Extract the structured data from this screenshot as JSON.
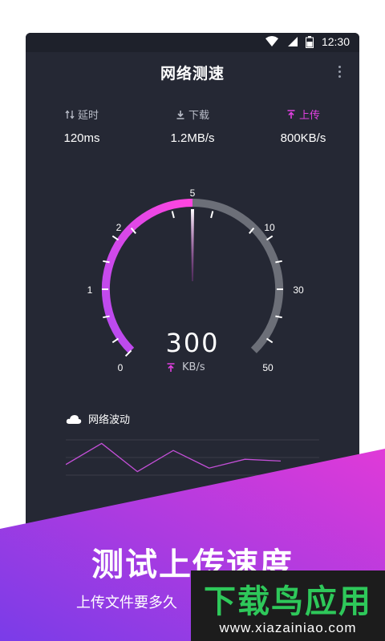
{
  "status_bar": {
    "time": "12:30"
  },
  "header": {
    "title": "网络测速"
  },
  "stats": [
    {
      "label": "延时",
      "value": "120ms",
      "icon": "latency-arrows-icon",
      "color": "#b9bdc8"
    },
    {
      "label": "下载",
      "value": "1.2MB/s",
      "icon": "download-icon",
      "color": "#b9bdc8"
    },
    {
      "label": "上传",
      "value": "800KB/s",
      "icon": "upload-icon",
      "color": "#e040e0"
    }
  ],
  "gauge": {
    "current_value": "300",
    "unit": "KB/s",
    "scale_labels": [
      "0",
      "1",
      "2",
      "5",
      "10",
      "30",
      "50"
    ],
    "needle_position_label": "5",
    "accent_gradient": [
      "#b34bf0",
      "#ff45e0"
    ],
    "track_color": "#6c6f78"
  },
  "wave": {
    "title": "网络波动",
    "points": [
      0.3,
      0.9,
      0.1,
      0.7,
      0.2,
      0.45,
      0.4
    ],
    "line_color": "#c44fd8"
  },
  "promo": {
    "title": "测试上传速度",
    "subtitle": "上传文件要多久",
    "gradient": [
      "#7a3ce8",
      "#e03ad8"
    ]
  },
  "watermark": {
    "title": "下载鸟应用",
    "url": "www.xiazainiao.com"
  }
}
